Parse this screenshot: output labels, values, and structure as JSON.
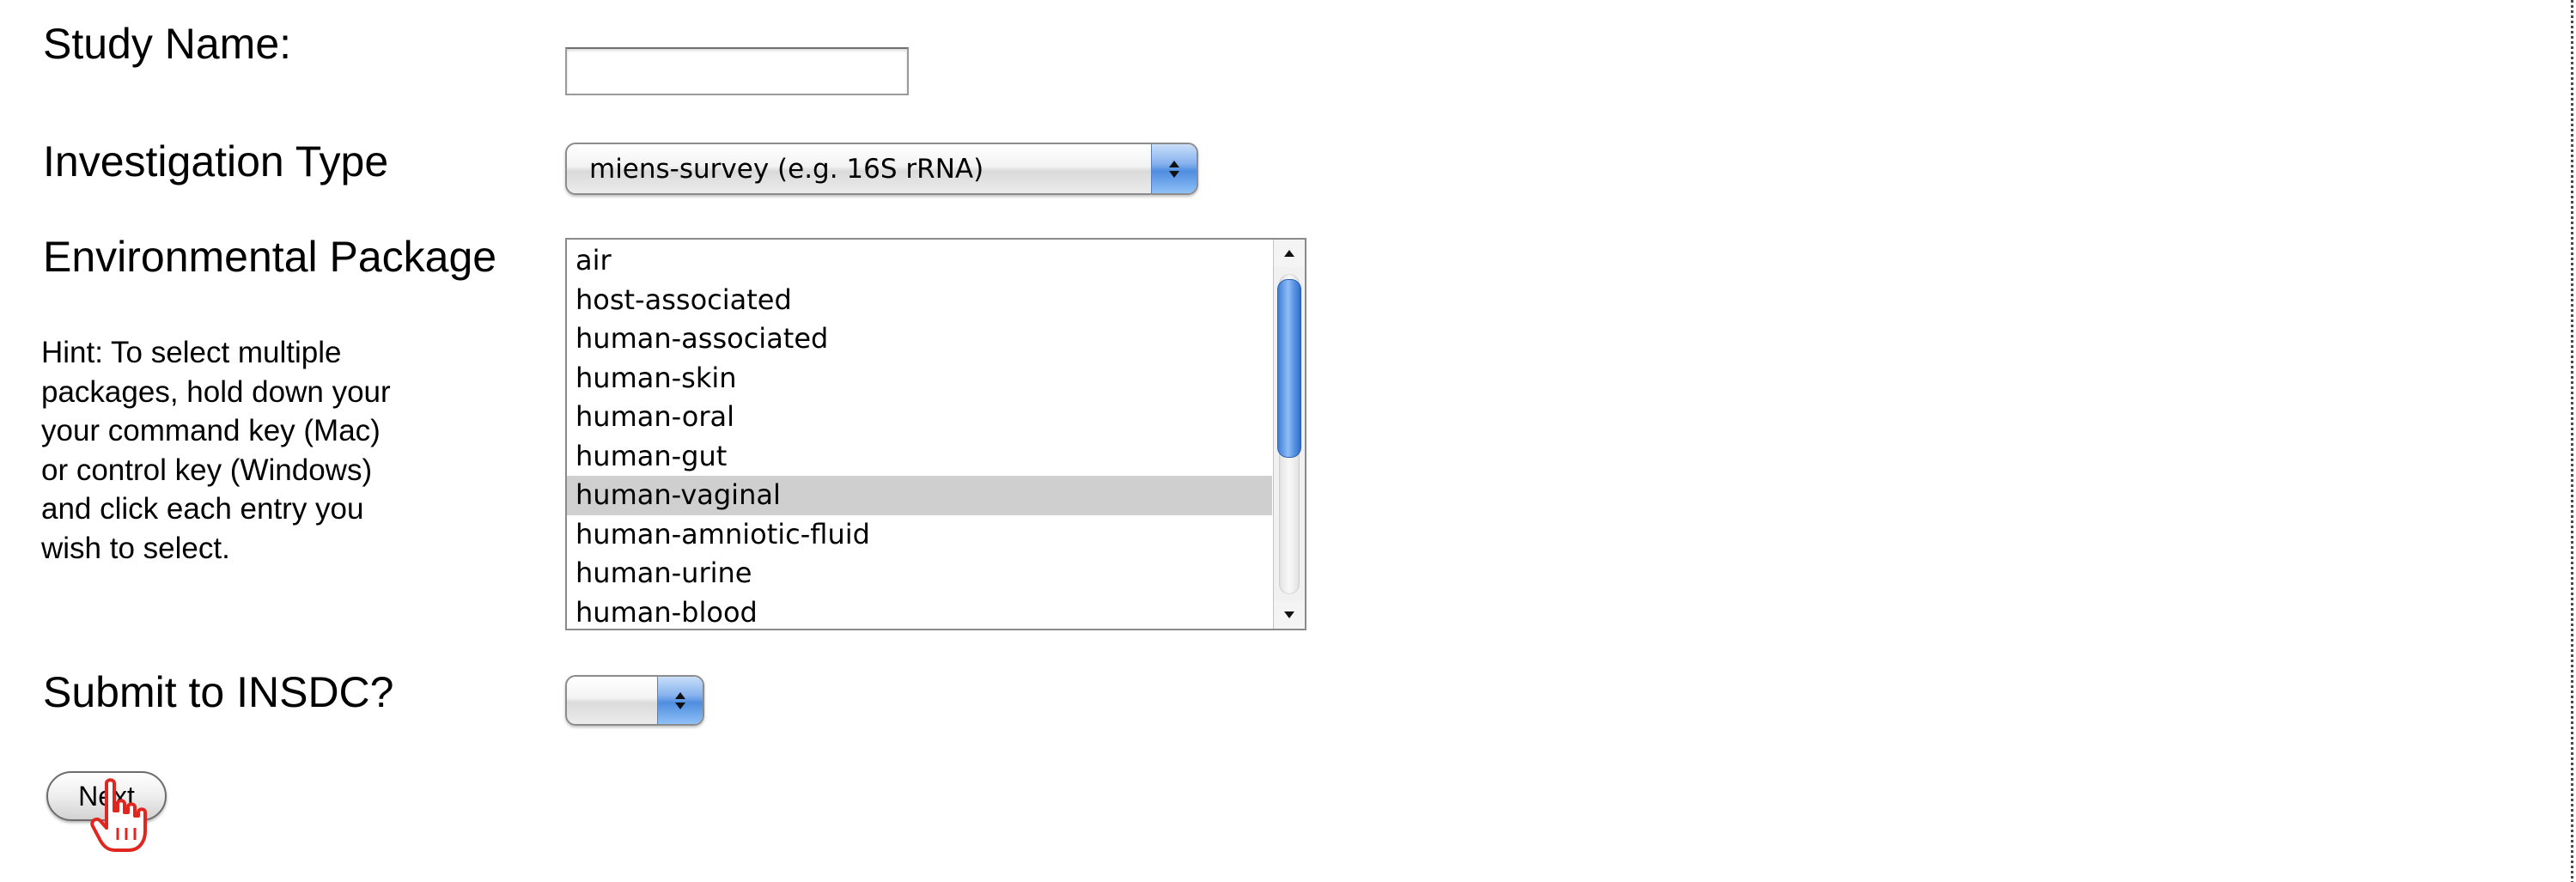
{
  "form": {
    "study_name": {
      "label": "Study Name:",
      "value": "",
      "placeholder": ""
    },
    "investigation_type": {
      "label": "Investigation Type",
      "selected": "miens-survey (e.g. 16S rRNA)"
    },
    "environmental_package": {
      "label": "Environmental Package",
      "hint": "Hint: To select multiple packages, hold down your your command key (Mac) or control key (Windows) and click each entry you wish to select.",
      "options": [
        "air",
        "host-associated",
        "human-associated",
        "human-skin",
        "human-oral",
        "human-gut",
        "human-vaginal",
        "human-amniotic-fluid",
        "human-urine",
        "human-blood"
      ],
      "selected": "human-vaginal"
    },
    "submit_to_insdc": {
      "label": "Submit to INSDC?",
      "selected": ""
    },
    "next_button": {
      "label": "Next"
    }
  },
  "icons": {
    "popup_arrows": "up-down-arrows-icon",
    "cursor": "pointing-hand-cursor-icon"
  },
  "colors": {
    "selected_row": "#cfcfcf",
    "aqua_blue": "#4f8ddf",
    "cursor_red": "#e0271f"
  }
}
